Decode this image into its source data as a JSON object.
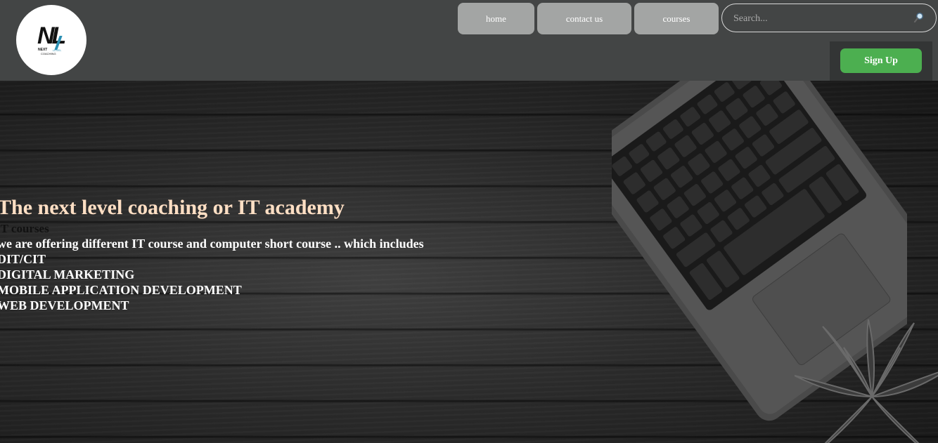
{
  "header": {
    "logo": {
      "text": "NL",
      "sub1": "NEXT",
      "sub2": "LEVEL",
      "sub3": "COACHING"
    },
    "nav": [
      {
        "label": "home"
      },
      {
        "label": "contact us"
      },
      {
        "label": "courses"
      }
    ],
    "search": {
      "placeholder": "Search..."
    },
    "signup_label": "Sign Up"
  },
  "hero": {
    "title": "The next level coaching or IT academy",
    "subtitle": "IT courses",
    "lines": [
      "we are offering different IT course and computer short course .. which includes",
      "DIT/CIT",
      "DIGITAL MARKETING",
      "MOBILE APPLICATION DEVELOPMENT",
      "WEB DEVELOPMENT"
    ]
  },
  "colors": {
    "header_bg": "#434545",
    "nav_button_bg": "#a3a5a4",
    "signup_bg": "#4caf50",
    "title_color": "#ffdfc4"
  }
}
